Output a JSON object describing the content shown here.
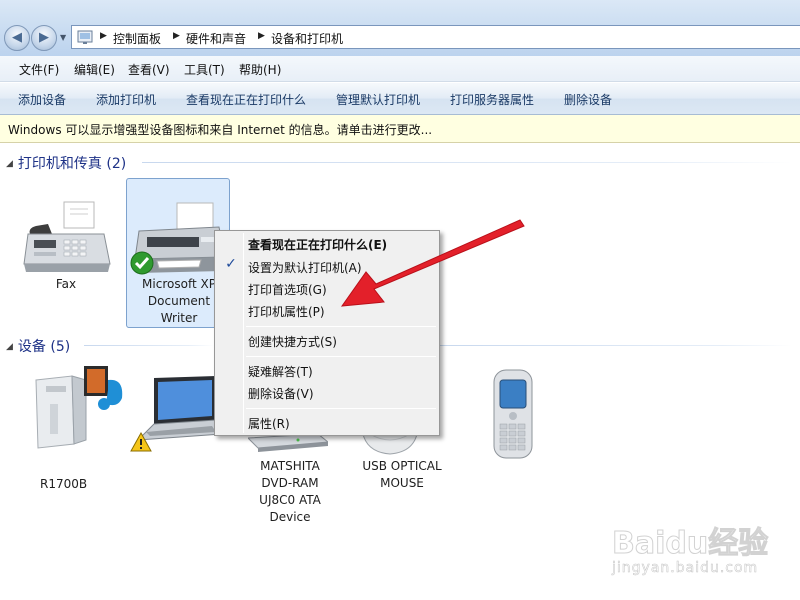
{
  "address_bar": {
    "back_icon": "back-arrow-icon",
    "forward_icon": "forward-arrow-icon",
    "breadcrumbs": [
      "控制面板",
      "硬件和声音",
      "设备和打印机"
    ]
  },
  "menu": {
    "items": [
      "文件(F)",
      "编辑(E)",
      "查看(V)",
      "工具(T)",
      "帮助(H)"
    ]
  },
  "commands": {
    "items": [
      "添加设备",
      "添加打印机",
      "查看现在正在打印什么",
      "管理默认打印机",
      "打印服务器属性",
      "删除设备"
    ]
  },
  "infobar": {
    "text": "Windows 可以显示增强型设备图标和来自 Internet 的信息。请单击进行更改..."
  },
  "groups": {
    "printers": {
      "title": "打印机和传真 (2)",
      "devices": [
        {
          "name": "Fax",
          "icon": "fax-icon"
        },
        {
          "name_lines": [
            "Microsoft XP",
            "Document",
            "Writer"
          ],
          "icon": "printer-icon",
          "default": true
        }
      ]
    },
    "devices": {
      "title": "设备 (5)",
      "devices": [
        {
          "label_visible": "R1700B",
          "icon": "media-center-pc-icon"
        },
        {
          "label_visible": "",
          "icon": "laptop-icon",
          "warning": true
        },
        {
          "name_lines": [
            "MATSHITA",
            "DVD-RAM",
            "UJ8C0 ATA",
            "Device"
          ],
          "icon": "optical-drive-icon"
        },
        {
          "name_lines": [
            "USB OPTICAL",
            "MOUSE"
          ],
          "icon": "mouse-icon"
        },
        {
          "label_visible": "",
          "icon": "mobile-phone-icon"
        }
      ]
    }
  },
  "context_menu": {
    "items": [
      {
        "label": "查看现在正在打印什么(E)",
        "bold": true
      },
      {
        "label": "设置为默认打印机(A)",
        "checked": true
      },
      {
        "label": "打印首选项(G)"
      },
      {
        "label": "打印机属性(P)"
      },
      {
        "label": "创建快捷方式(S)"
      },
      {
        "label": "疑难解答(T)"
      },
      {
        "label": "删除设备(V)"
      },
      {
        "label": "属性(R)"
      }
    ]
  },
  "annotation": {
    "arrow_color": "#e3202a"
  },
  "watermark": {
    "logo": "Baidu经验",
    "url": "jingyan.baidu.com"
  }
}
